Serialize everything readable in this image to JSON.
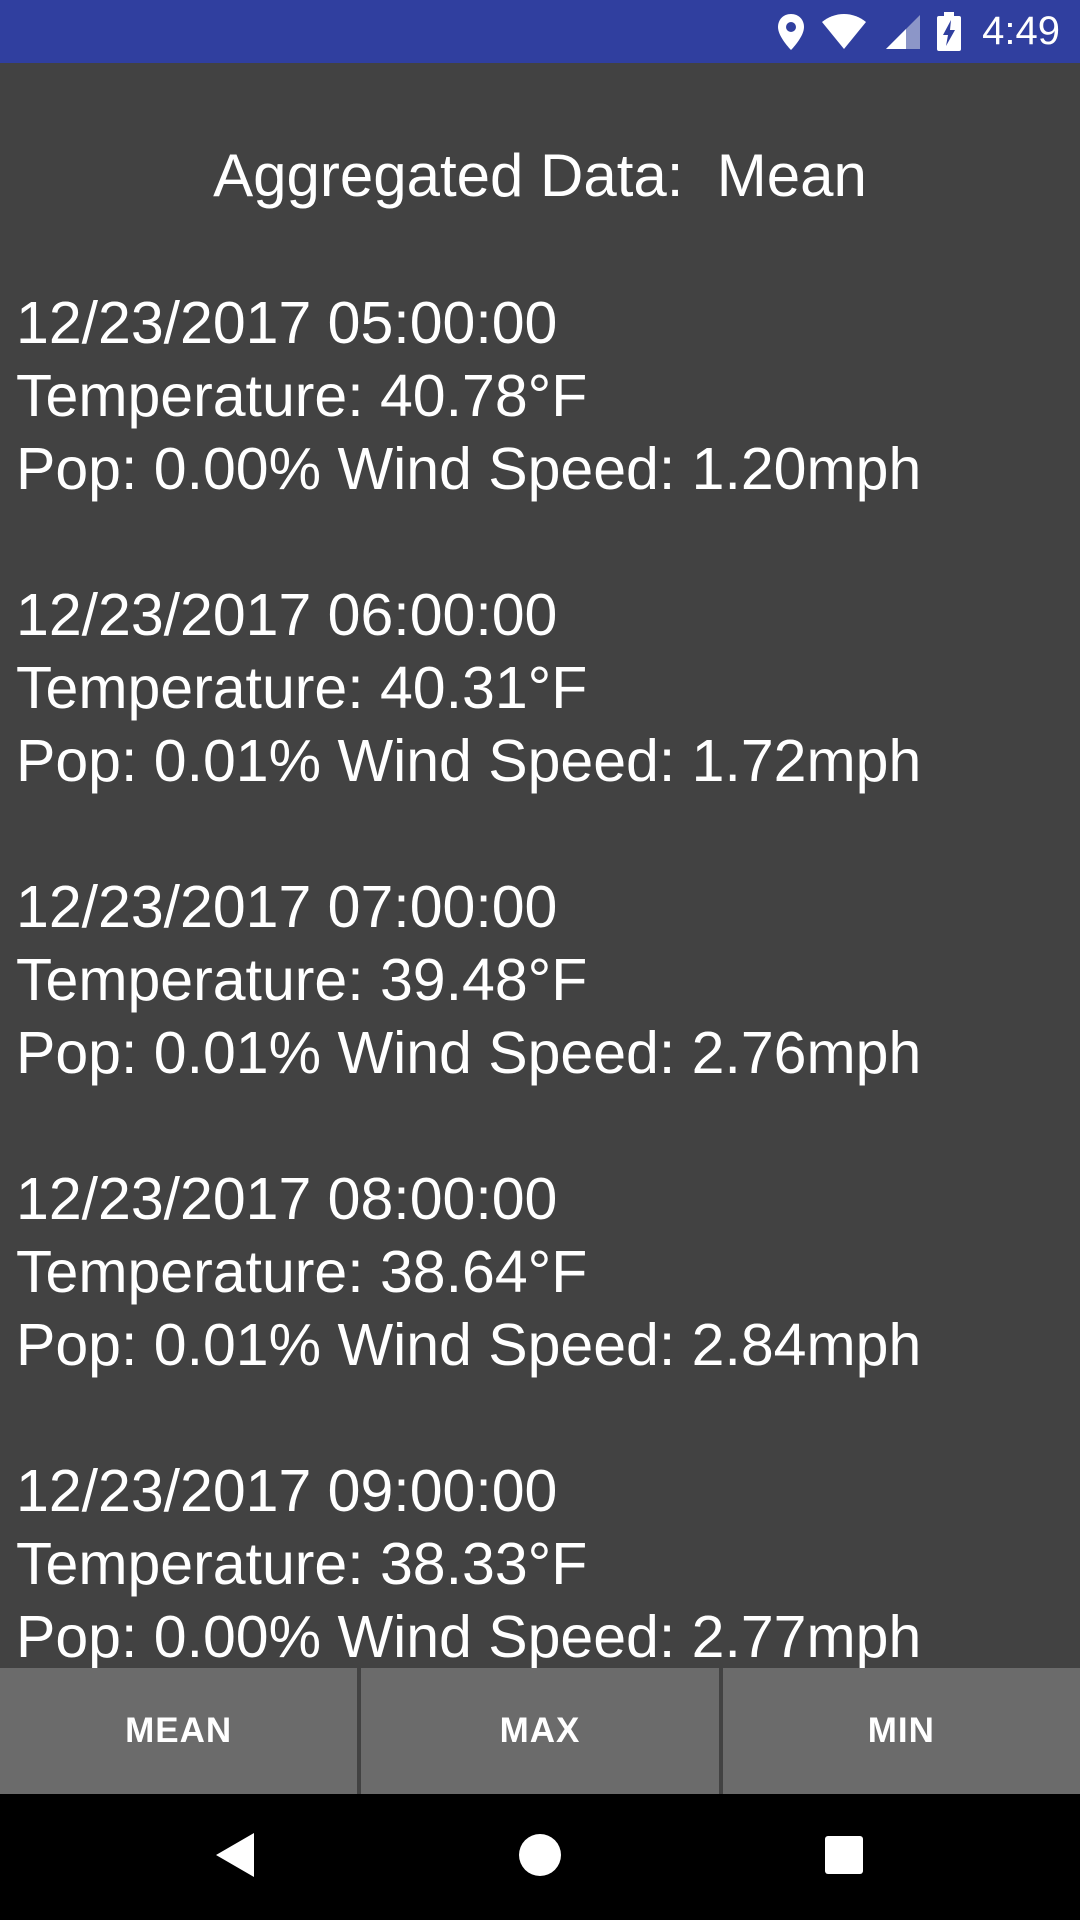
{
  "status_bar": {
    "time": "4:49",
    "background_color": "#303F9F",
    "icons": [
      "location-icon",
      "wifi-icon",
      "cell-signal-icon",
      "battery-charging-icon"
    ]
  },
  "screen": {
    "title": "Aggregated Data:  Mean",
    "records": [
      {
        "datetime": "12/23/2017 05:00:00",
        "temperature": "Temperature: 40.78°F",
        "pop_wind": "Pop: 0.00% Wind Speed: 1.20mph"
      },
      {
        "datetime": "12/23/2017 06:00:00",
        "temperature": "Temperature: 40.31°F",
        "pop_wind": "Pop: 0.01% Wind Speed: 1.72mph"
      },
      {
        "datetime": "12/23/2017 07:00:00",
        "temperature": "Temperature: 39.48°F",
        "pop_wind": "Pop: 0.01% Wind Speed: 2.76mph"
      },
      {
        "datetime": "12/23/2017 08:00:00",
        "temperature": "Temperature: 38.64°F",
        "pop_wind": "Pop: 0.01% Wind Speed: 2.84mph"
      },
      {
        "datetime": "12/23/2017 09:00:00",
        "temperature": "Temperature: 38.33°F",
        "pop_wind": "Pop: 0.00% Wind Speed: 2.77mph"
      }
    ]
  },
  "tabs": [
    {
      "label": "MEAN"
    },
    {
      "label": "MAX"
    },
    {
      "label": "MIN"
    }
  ],
  "nav_bar": {
    "icons": [
      "back-icon",
      "home-icon",
      "recents-icon"
    ]
  }
}
